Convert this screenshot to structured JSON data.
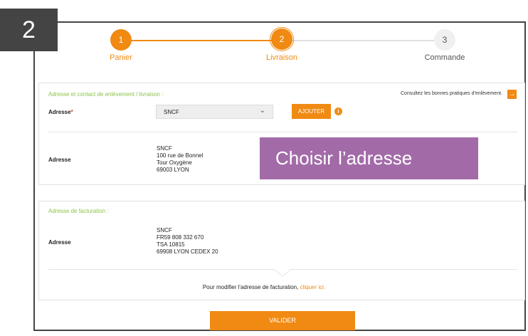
{
  "slide": {
    "number": "2"
  },
  "steps": [
    {
      "num": "1",
      "label": "Panier"
    },
    {
      "num": "2",
      "label": "Livraison"
    },
    {
      "num": "3",
      "label": "Commande"
    }
  ],
  "pickup": {
    "section_title": "Adresse et contact de enlèvement / livraison :",
    "good_practice_link": "Consultez les bonnes pratiques d'enlèvement.",
    "address_label": "Adresse",
    "required_mark": "*",
    "select_value": "SNCF",
    "add_button": "AJOUTER",
    "info_icon": "i",
    "detail_label": "Adresse",
    "detail_lines": "SNCF\n100 rue de Bonnel\nTour Oxygène\n69003 LYON"
  },
  "overlay_text": "Choisir l’adresse",
  "billing": {
    "section_title": "Adresse de facturation :",
    "detail_label": "Adresse",
    "detail_lines": "SNCF\nFR59 808 332 670\nTSA 10815\n69908 LYON CEDEX 20",
    "modify_text": "Pour modifier l'adresse de facturation,",
    "modify_link": "cliquer ici."
  },
  "validate_button": "VALIDER",
  "colors": {
    "accent": "#f08a12",
    "green_title": "#8bc34a",
    "overlay": "#a26ba8"
  },
  "icons": {
    "arrow": "arrow-right-icon",
    "info": "info-icon",
    "chevron": "chevron-down-icon"
  }
}
